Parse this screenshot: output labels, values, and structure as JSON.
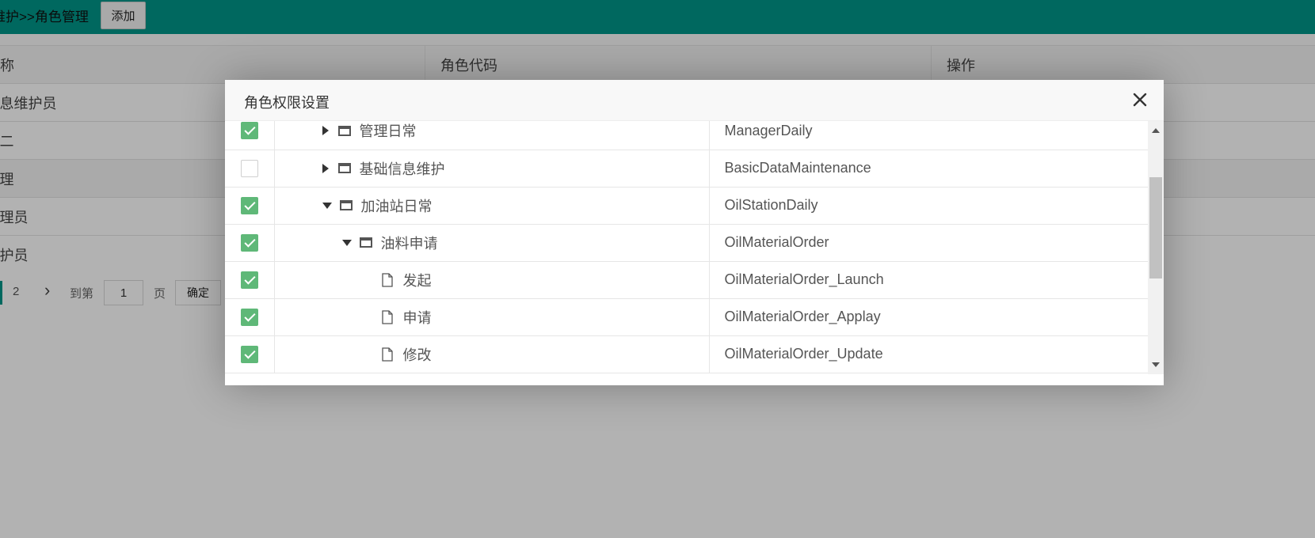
{
  "header": {
    "breadcrumb": "维护>>角色管理",
    "add_button": "添加"
  },
  "role_table": {
    "columns": [
      "称",
      "角色代码",
      "操作"
    ],
    "rows": [
      {
        "name": "息维护员",
        "selected": false
      },
      {
        "name": "二",
        "selected": false
      },
      {
        "name": "理",
        "selected": true
      },
      {
        "name": "理员",
        "selected": false
      },
      {
        "name": "护员",
        "selected": false
      }
    ]
  },
  "pager": {
    "page_2": "2",
    "goto_label": "到第",
    "page_input_value": "1",
    "page_unit": "页",
    "confirm_label": "确定"
  },
  "colors": {
    "accent": "#009688",
    "checkbox_checked": "#5fb878"
  },
  "modal": {
    "title": "角色权限设置",
    "close_icon": "close-icon",
    "tree_rows": [
      {
        "checked": true,
        "expander": "right",
        "icon": "folder-icon",
        "indent": 0,
        "name": "管理日常",
        "code": "ManagerDaily"
      },
      {
        "checked": false,
        "expander": "right",
        "icon": "folder-icon",
        "indent": 0,
        "name": "基础信息维护",
        "code": "BasicDataMaintenance"
      },
      {
        "checked": true,
        "expander": "down",
        "icon": "folder-icon",
        "indent": 0,
        "name": "加油站日常",
        "code": "OilStationDaily"
      },
      {
        "checked": true,
        "expander": "down",
        "icon": "folder-icon",
        "indent": 1,
        "name": "油料申请",
        "code": "OilMaterialOrder"
      },
      {
        "checked": true,
        "expander": "none",
        "icon": "file-icon",
        "indent": 2,
        "name": "发起",
        "code": "OilMaterialOrder_Launch"
      },
      {
        "checked": true,
        "expander": "none",
        "icon": "file-icon",
        "indent": 2,
        "name": "申请",
        "code": "OilMaterialOrder_Applay"
      },
      {
        "checked": true,
        "expander": "none",
        "icon": "file-icon",
        "indent": 2,
        "name": "修改",
        "code": "OilMaterialOrder_Update"
      }
    ]
  }
}
